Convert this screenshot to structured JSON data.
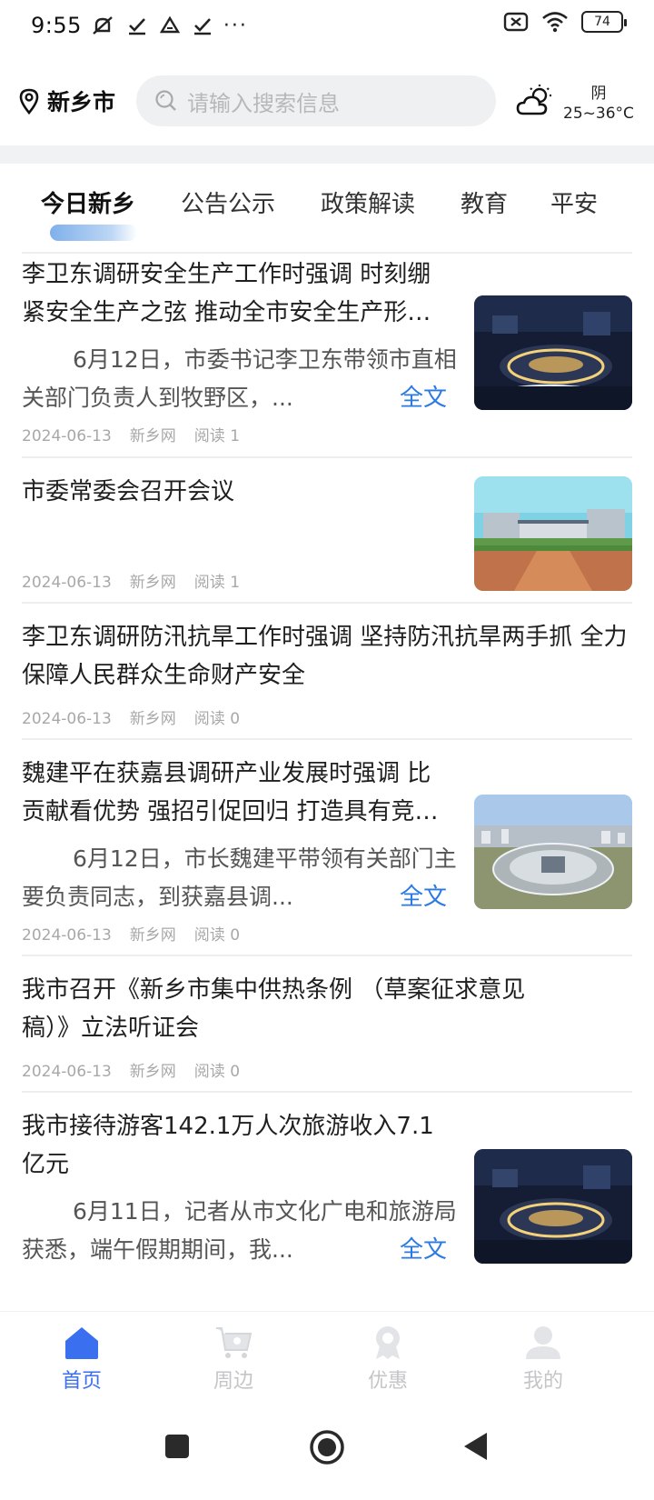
{
  "status_bar": {
    "time": "9:55",
    "battery": "74",
    "more": "···",
    "icons": [
      "mute-icon",
      "check-icon",
      "drive-icon",
      "check-icon",
      "sim-off-icon",
      "wifi-icon",
      "battery-icon"
    ]
  },
  "header": {
    "city": "新乡市",
    "search_placeholder": "请输入搜索信息",
    "weather_condition": "阴",
    "weather_temp": "25~36°C"
  },
  "tabs": [
    {
      "label": "今日新乡",
      "active": true
    },
    {
      "label": "公告公示",
      "active": false
    },
    {
      "label": "政策解读",
      "active": false
    },
    {
      "label": "教育",
      "active": false
    },
    {
      "label": "平安",
      "active": false
    }
  ],
  "news": [
    {
      "title": "李卫东调研安全生产工作时强调 时刻绷紧安全生产之弦 推动全市安全生产形势持续稳定向好",
      "summary": "6月12日，市委书记李卫东带领市直相关部门负责人到牧野区，...",
      "full_label": "全文",
      "date": "2024-06-13",
      "source": "新乡网",
      "reads": "阅读 1",
      "image": "city-night-building-photo"
    },
    {
      "title": "市委常委会召开会议",
      "date": "2024-06-13",
      "source": "新乡网",
      "reads": "阅读 1",
      "image": "government-building-plaza-photo"
    },
    {
      "title": "李卫东调研防汛抗旱工作时强调 坚持防汛抗旱两手抓 全力保障人民群众生命财产安全",
      "date": "2024-06-13",
      "source": "新乡网",
      "reads": "阅读 0"
    },
    {
      "title": "魏建平在获嘉县调研产业发展时强调 比贡献看优势 强招引促回归 打造具有竞争力的产业集群",
      "summary": "6月12日，市长魏建平带领有关部门主要负责同志，到获嘉县调...",
      "full_label": "全文",
      "date": "2024-06-13",
      "source": "新乡网",
      "reads": "阅读 0",
      "image": "aerial-stadium-photo"
    },
    {
      "title": "我市召开《新乡市集中供热条例 （草案征求意见稿）》立法听证会",
      "date": "2024-06-13",
      "source": "新乡网",
      "reads": "阅读 0"
    },
    {
      "title": "我市接待游客142.1万人次旅游收入7.1亿元",
      "summary": "6月11日，记者从市文化广电和旅游局获悉，端午假期期间，我...",
      "full_label": "全文",
      "date": "2024-06-13",
      "source": "新乡网",
      "reads": "阅读 0",
      "image": "city-night-building-photo"
    }
  ],
  "bottom_nav": [
    {
      "label": "首页",
      "icon": "home-icon",
      "active": true
    },
    {
      "label": "周边",
      "icon": "cart-icon",
      "active": false
    },
    {
      "label": "优惠",
      "icon": "award-icon",
      "active": false
    },
    {
      "label": "我的",
      "icon": "person-icon",
      "active": false
    }
  ],
  "colors": {
    "accent": "#3a6ff0",
    "link": "#2a7ae2",
    "inactive_nav": "#c5c5c8",
    "meta": "#a8a8a8"
  }
}
